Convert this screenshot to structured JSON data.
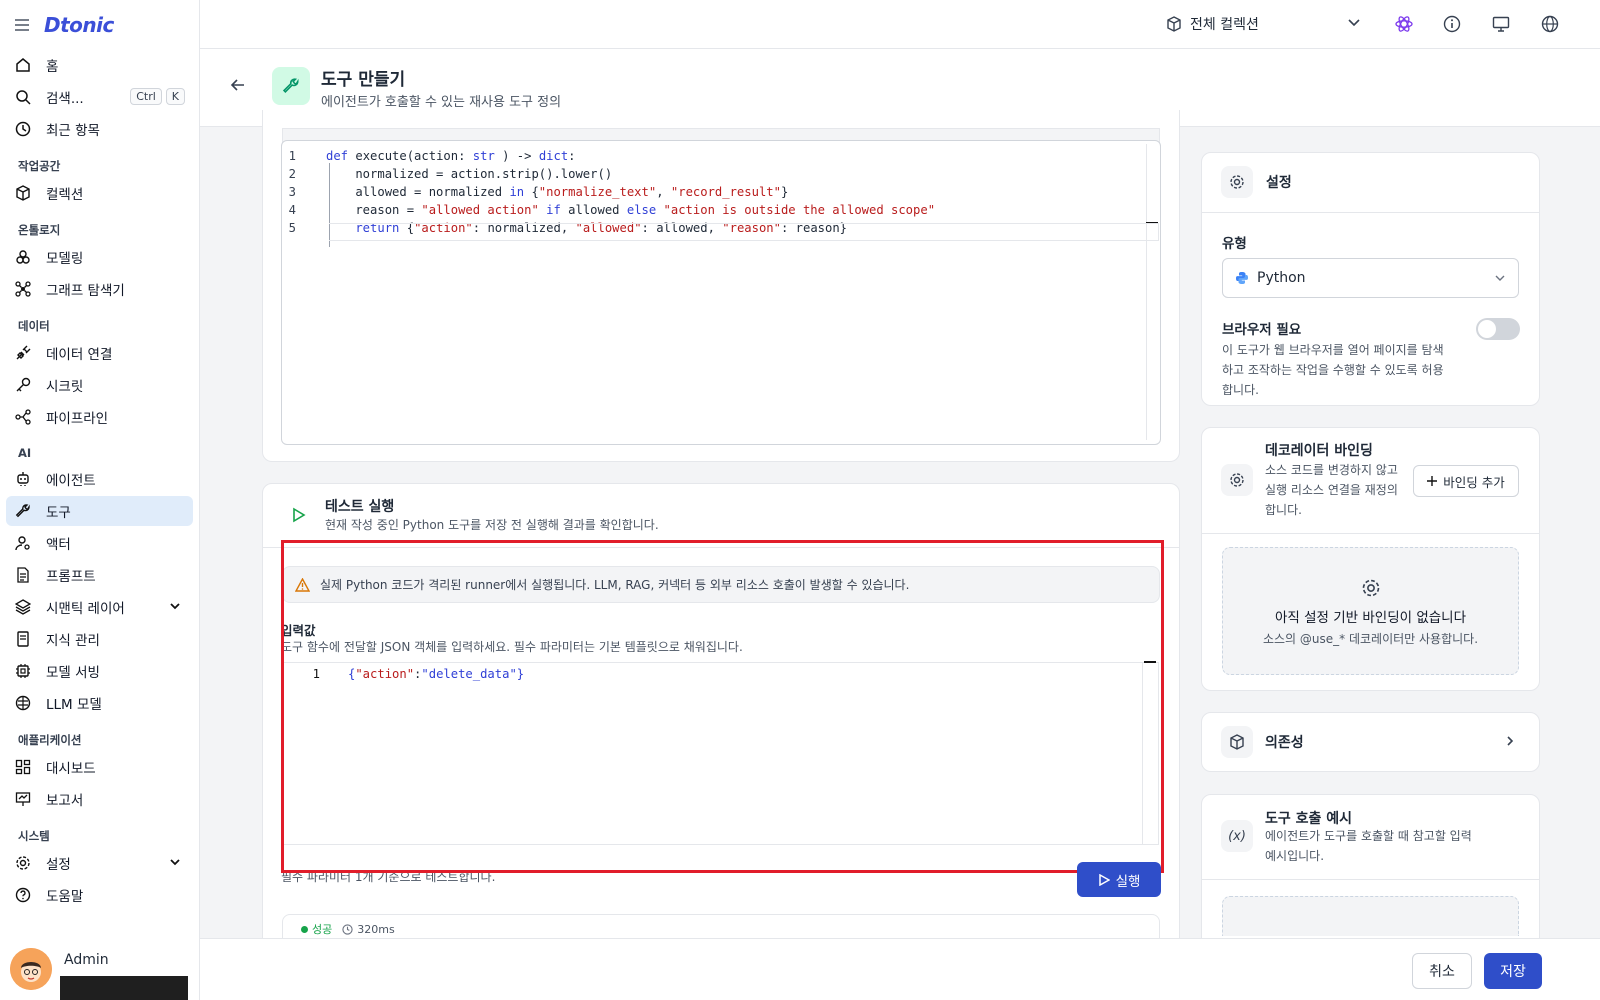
{
  "app": {
    "logo": "Dtonic"
  },
  "sidebar": {
    "home": "홈",
    "search": "검색...",
    "kbd_ctrl": "Ctrl",
    "kbd_k": "K",
    "recent": "최근 항목",
    "sections": {
      "workspace": "작업공간",
      "ontology": "온톨로지",
      "data": "데이터",
      "ai": "AI",
      "application": "애플리케이션",
      "system": "시스템"
    },
    "items": {
      "collection": "컬렉션",
      "modeling": "모델링",
      "graph": "그래프 탐색기",
      "data_connection": "데이터 연결",
      "secret": "시크릿",
      "pipeline": "파이프라인",
      "agent": "에이전트",
      "tool": "도구",
      "actor": "액터",
      "prompt": "프롬프트",
      "semantic": "시맨틱 레이어",
      "knowledge": "지식 관리",
      "model_serving": "모델 서빙",
      "llm": "LLM 모델",
      "dashboard": "대시보드",
      "report": "보고서",
      "settings": "설정",
      "help": "도움말"
    },
    "user": "Admin"
  },
  "topbar": {
    "collection": "전체 컬렉션"
  },
  "header": {
    "title": "도구 만들기",
    "subtitle": "에이전트가 호출할 수 있는 재사용 도구 정의"
  },
  "code": {
    "lines": [
      {
        "n": "1",
        "t": [
          [
            "kw",
            "def "
          ],
          [
            "",
            "execute(action: "
          ],
          [
            "kw",
            "str"
          ],
          [
            "",
            " ) -> "
          ],
          [
            "kw",
            "dict"
          ],
          [
            "",
            ":"
          ]
        ]
      },
      {
        "n": "2",
        "t": [
          [
            "",
            "    normalized = action.strip().lower()"
          ]
        ]
      },
      {
        "n": "3",
        "t": [
          [
            "",
            "    allowed = normalized "
          ],
          [
            "kw",
            "in "
          ],
          [
            "",
            "{"
          ],
          [
            "str",
            "\"normalize_text\""
          ],
          [
            "",
            ", "
          ],
          [
            "str",
            "\"record_result\""
          ],
          [
            "",
            "}"
          ]
        ]
      },
      {
        "n": "4",
        "t": [
          [
            "",
            "    reason = "
          ],
          [
            "str",
            "\"allowed action\" "
          ],
          [
            "kw",
            "if "
          ],
          [
            "",
            "allowed "
          ],
          [
            "kw",
            "else "
          ],
          [
            "str",
            "\"action is outside the allowed scope\""
          ]
        ]
      },
      {
        "n": "5",
        "t": [
          [
            "kw",
            "    return "
          ],
          [
            "",
            "{"
          ],
          [
            "str",
            "\"action\""
          ],
          [
            "",
            ": normalized, "
          ],
          [
            "str",
            "\"allowed\""
          ],
          [
            "",
            ": allowed, "
          ],
          [
            "str",
            "\"reason\""
          ],
          [
            "",
            ": reason}"
          ]
        ]
      }
    ]
  },
  "test": {
    "title": "테스트 실행",
    "subtitle": "현재 작성 중인 Python 도구를 저장 전 실행해 결과를 확인합니다.",
    "warning": "실제 Python 코드가 격리된 runner에서 실행됩니다. LLM, RAG, 커넥터 등 외부 리소스 호출이 발생할 수 있습니다.",
    "input_label": "입력값",
    "input_sub": "도구 함수에 전달할 JSON 객체를 입력하세요. 필수 파라미터는 기본 템플릿으로 채워집니다.",
    "json_line_no": "1",
    "json_key": "\"action\"",
    "json_value": "\"delete_data\"",
    "hint": "필수 파라미터 1개 기준으로 테스트합니다.",
    "run": "실행",
    "status": "성공",
    "duration": "320ms"
  },
  "settings": {
    "title": "설정",
    "type_label": "유형",
    "type_value": "Python",
    "browser_label": "브라우저 필요",
    "browser_desc": "이 도구가 웹 브라우저를 열어 페이지를 탐색하고 조작하는 작업을 수행할 수 있도록 허용합니다.",
    "browser_enabled": false
  },
  "decorator": {
    "title": "데코레이터 바인딩",
    "desc": "소스 코드를 변경하지 않고 실행 리소스 연결을 재정의합니다.",
    "add": "바인딩 추가",
    "empty_title": "아직 설정 기반 바인딩이 없습니다",
    "empty_sub": "소스의 @use_* 데코레이터만 사용합니다."
  },
  "deps": {
    "title": "의존성"
  },
  "example": {
    "title": "도구 호출 예시",
    "desc": "에이전트가 도구를 호출할 때 참고할 입력 예시입니다."
  },
  "footer": {
    "cancel": "취소",
    "save": "저장"
  }
}
